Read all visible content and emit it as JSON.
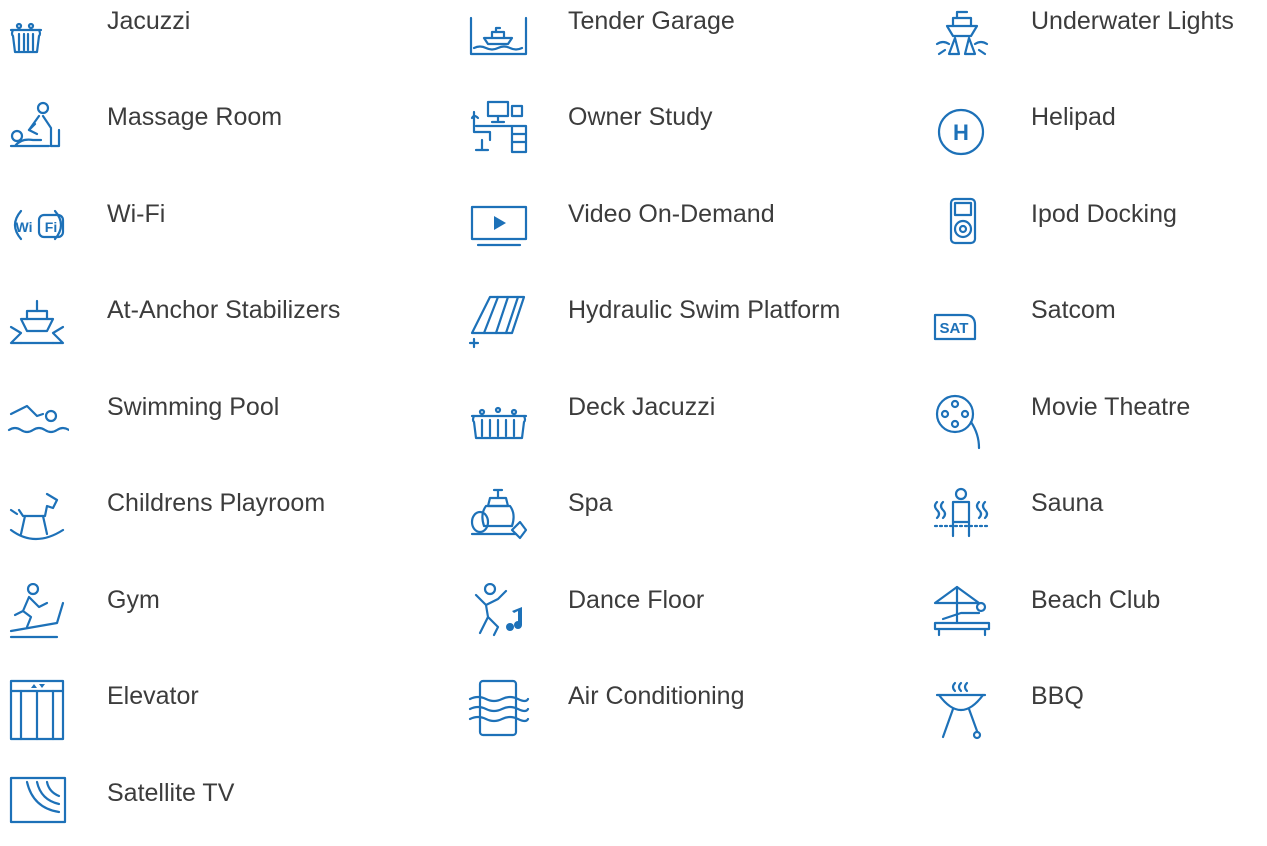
{
  "accent_color": "#1d71b8",
  "text_color": "#3c3c3c",
  "amenities": [
    {
      "label": "Jacuzzi",
      "icon": "jacuzzi-icon"
    },
    {
      "label": "Tender Garage",
      "icon": "tender-garage-icon"
    },
    {
      "label": "Underwater Lights",
      "icon": "underwater-lights-icon"
    },
    {
      "label": "Massage Room",
      "icon": "massage-icon"
    },
    {
      "label": "Owner Study",
      "icon": "study-desk-icon"
    },
    {
      "label": "Helipad",
      "icon": "helipad-icon",
      "glyph": "H"
    },
    {
      "label": "Wi-Fi",
      "icon": "wifi-icon",
      "glyph_left": "Wi",
      "glyph_right": "Fi"
    },
    {
      "label": "Video On-Demand",
      "icon": "video-play-icon"
    },
    {
      "label": "Ipod Docking",
      "icon": "ipod-icon"
    },
    {
      "label": "At-Anchor Stabilizers",
      "icon": "stabilizers-icon"
    },
    {
      "label": "Hydraulic Swim Platform",
      "icon": "swim-platform-icon"
    },
    {
      "label": "Satcom",
      "icon": "satcom-icon",
      "glyph": "SAT"
    },
    {
      "label": "Swimming Pool",
      "icon": "swimmer-icon"
    },
    {
      "label": "Deck Jacuzzi",
      "icon": "deck-jacuzzi-icon"
    },
    {
      "label": "Movie Theatre",
      "icon": "film-reel-icon"
    },
    {
      "label": "Childrens Playroom",
      "icon": "rocking-horse-icon"
    },
    {
      "label": "Spa",
      "icon": "spa-icon"
    },
    {
      "label": "Sauna",
      "icon": "sauna-icon"
    },
    {
      "label": "Gym",
      "icon": "treadmill-icon"
    },
    {
      "label": "Dance Floor",
      "icon": "dancer-icon"
    },
    {
      "label": "Beach Club",
      "icon": "beach-club-icon"
    },
    {
      "label": "Elevator",
      "icon": "elevator-icon"
    },
    {
      "label": "Air Conditioning",
      "icon": "air-conditioning-icon"
    },
    {
      "label": "BBQ",
      "icon": "bbq-icon"
    },
    {
      "label": "Satellite TV",
      "icon": "satellite-tv-icon"
    }
  ]
}
